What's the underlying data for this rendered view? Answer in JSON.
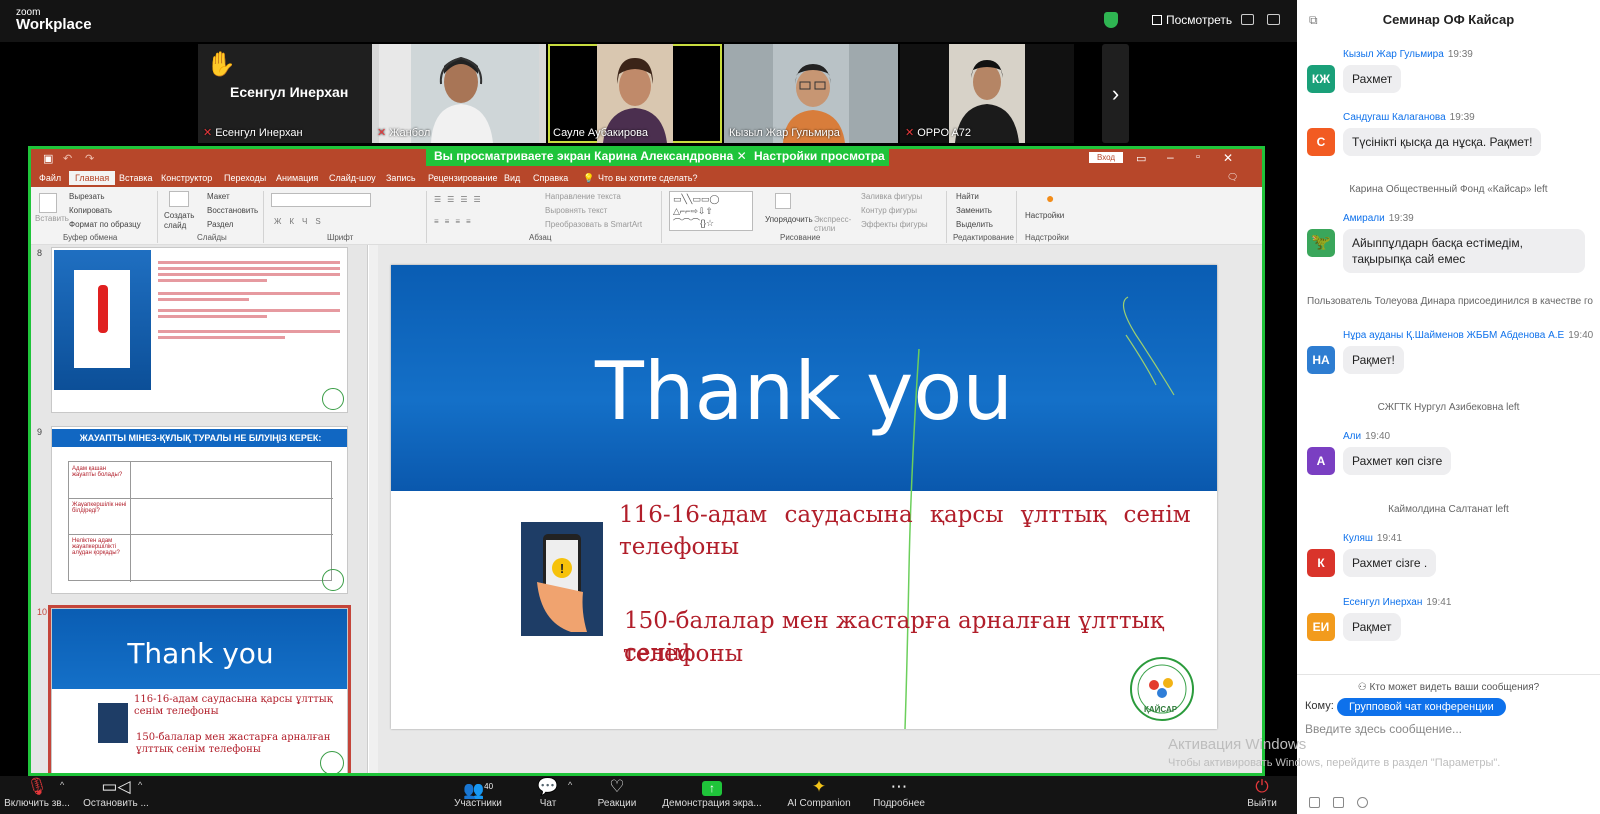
{
  "app": {
    "logo_top": "zoom",
    "logo_bottom": "Workplace"
  },
  "topbar": {
    "view_label": "Посмотреть"
  },
  "participants": [
    {
      "name": "Есенгул Инерхан",
      "big_name": "Есенгул Инерхан",
      "muted": true,
      "hand": "✋"
    },
    {
      "name": "Жанбол",
      "muted": true
    },
    {
      "name": "Сауле Аубакирова",
      "muted": false
    },
    {
      "name": "Кызыл Жар Гульмира",
      "muted": false
    },
    {
      "name": "OPPO A72",
      "muted": true
    }
  ],
  "share": {
    "banner": "Вы просматриваете экран  Карина Александровна",
    "settings": "Настройки просмотра"
  },
  "ppt": {
    "signin": "Вход",
    "tabs": [
      "Файл",
      "Главная",
      "Вставка",
      "Конструктор",
      "Переходы",
      "Анимация",
      "Слайд-шоу",
      "Запись",
      "Рецензирование",
      "Вид",
      "Справка"
    ],
    "tell_me": "Что вы хотите сделать?",
    "ribbon": {
      "paste": "Вставить",
      "cut": "Вырезать",
      "copy": "Копировать",
      "format": "Формат по образцу",
      "create": "Создать слайд",
      "layout": "Макет",
      "reset": "Восстановить",
      "section": "Раздел",
      "text_dir": "Направление текста",
      "align_text": "Выровнять текст",
      "smartart": "Преобразовать в SmartArt",
      "arrange": "Упорядочить",
      "styles": "Экспресс-стили",
      "fill": "Заливка фигуры",
      "outline": "Контур фигуры",
      "effects": "Эффекты фигуры",
      "find": "Найти",
      "replace": "Заменить",
      "select": "Выделить",
      "settings": "Настройки",
      "groups": [
        "Буфер обмена",
        "Слайды",
        "Шрифт",
        "Абзац",
        "Рисование",
        "Редактирование",
        "Надстройки"
      ]
    },
    "thumbs": [
      {
        "num": "8"
      },
      {
        "num": "9",
        "header": "ЖАУАПТЫ МІНЕЗ-ҚҰЛЫҚ ТУРАЛЫ НЕ БІЛУІҢІЗ КЕРЕК:",
        "rows": [
          "Адам қашан жауапты болады?",
          "Жауапкершілік нені білдіреді?",
          "Неліктен адам жауапкершілікті алудан қорқады?"
        ]
      },
      {
        "num": "10",
        "title": "Thank you",
        "line1": "116-16-адам саудасына қарсы ұлттық сенім телефоны",
        "line2": "150-балалар мен жастарға арналған ұлттық сенім телефоны"
      }
    ],
    "slide": {
      "title": "Thank you",
      "line1a": "116-16-адам  саудасына  қарсы  ұлттық  сенім",
      "line1b": "телефоны",
      "line2a": "150-балалар мен жастарға арналған ұлттық сенім",
      "line2b": "телефоны",
      "seal_text": "ҚАЙСАР"
    }
  },
  "chat": {
    "title": "Семинар ОФ Кайсар",
    "messages": [
      {
        "initials": "КЖ",
        "color": "#1aa079",
        "sender": "Кызыл Жар Гульмира",
        "time": "19:39",
        "text": "Рахмет"
      },
      {
        "initials": "С",
        "color": "#f25b22",
        "sender": "Сандугаш Калаганова",
        "time": "19:39",
        "text": "Түсінікті қысқа да нұсқа. Рақмет!"
      },
      {
        "initials": "",
        "color": "#3aa65b",
        "sender": "Амирали",
        "time": "19:39",
        "text": "Айыппұлдарн басқа естімедім, тақырыпқа сай емес"
      },
      {
        "initials": "НА",
        "color": "#2e7dd1",
        "sender": "Нұра ауданы Қ.Шайменов ЖББМ Абденова А.Е",
        "time": "19:40",
        "text": "Рақмет!"
      },
      {
        "initials": "А",
        "color": "#7a3fc2",
        "sender": "Али",
        "time": "19:40",
        "text": "Рахмет көп сізге"
      },
      {
        "initials": "К",
        "color": "#d9342b",
        "sender": "Куляш",
        "time": "19:41",
        "text": "Рахмет сізге ."
      },
      {
        "initials": "ЕИ",
        "color": "#f29b1d",
        "sender": "Есенгул Инерхан",
        "time": "19:41",
        "text": "Рақмет"
      }
    ],
    "system": [
      "Карина Общественный Фонд «Кайсар» left",
      "Пользователь Толеуова Динара присоединился в качестве го",
      "СЖГТК Нургул Азибековна left",
      "Каймолдина Салтанат left"
    ],
    "who_can_see": "Кто может видеть ваши сообщения?",
    "to_label": "Кому:",
    "to_value": "Групповой чат конференции",
    "placeholder": "Введите здесь сообщение..."
  },
  "toolbar": {
    "mic": "Включить зв...",
    "video": "Остановить ...",
    "participants": "Участники",
    "participants_count": "40",
    "chat": "Чат",
    "reactions": "Реакции",
    "share": "Демонстрация экра...",
    "ai": "AI Companion",
    "more": "Подробнее",
    "leave": "Выйти"
  },
  "watermark": {
    "line1": "Активация Windows",
    "line2": "Чтобы активировать Windows, перейдите в раздел \"Параметры\"."
  }
}
